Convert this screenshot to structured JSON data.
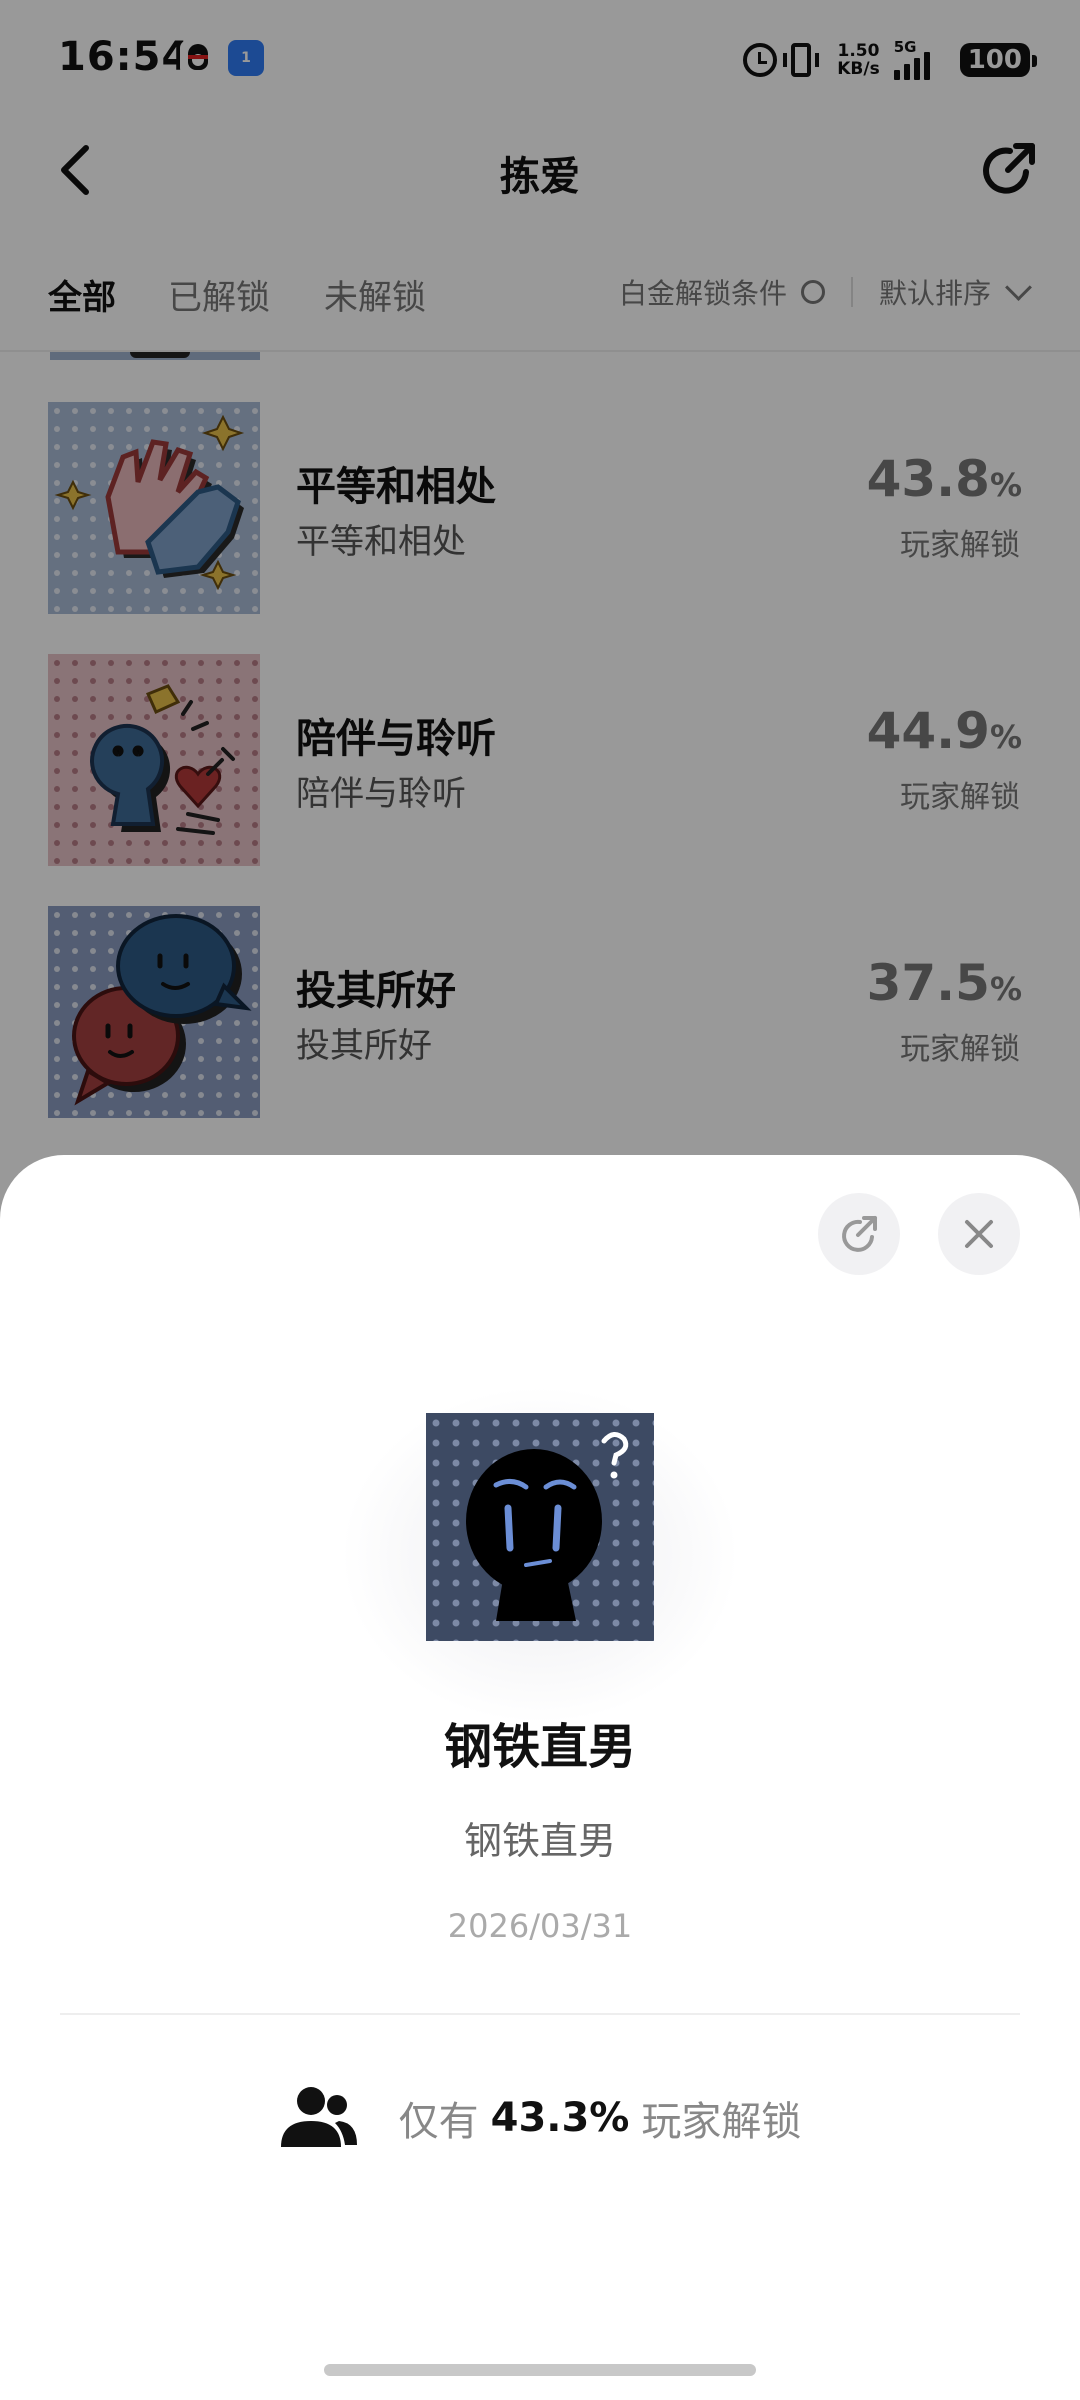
{
  "status_bar": {
    "time": "16:54",
    "net_speed_value": "1.50",
    "net_speed_unit": "KB/s",
    "signal_type": "5G",
    "battery": "100",
    "radio_badge": "1",
    "icons": [
      "qq-icon",
      "radio-icon",
      "alarm-icon",
      "vibrate-icon",
      "signal-icon",
      "battery-icon"
    ]
  },
  "nav": {
    "title": "拣爱",
    "back_icon": "back-arrow-icon",
    "share_icon": "share-icon"
  },
  "filter": {
    "tabs": [
      {
        "label": "全部",
        "active": true
      },
      {
        "label": "已解锁",
        "active": false
      },
      {
        "label": "未解锁",
        "active": false
      }
    ],
    "platinum_label": "白金解锁条件",
    "sort_label": "默认排序"
  },
  "achievements": [
    {
      "title": "平等和相处",
      "subtitle": "平等和相处",
      "percent": "43.8",
      "percent_sign": "%",
      "percent_label": "玩家解锁",
      "icon": "handshake-icon"
    },
    {
      "title": "陪伴与聆听",
      "subtitle": "陪伴与聆听",
      "percent": "44.9",
      "percent_sign": "%",
      "percent_label": "玩家解锁",
      "icon": "companion-heart-icon"
    },
    {
      "title": "投其所好",
      "subtitle": "投其所好",
      "percent": "37.5",
      "percent_sign": "%",
      "percent_label": "玩家解锁",
      "icon": "chat-bubbles-icon"
    }
  ],
  "sheet": {
    "title": "钢铁直男",
    "subtitle": "钢铁直男",
    "date": "2026/03/31",
    "unlock_prefix": "仅有",
    "unlock_percent": "43.3%",
    "unlock_suffix": "玩家解锁",
    "badge_icon": "confused-face-icon"
  },
  "colors": {
    "overlay": "#000000",
    "thumb_blue": "#a9bbd6",
    "thumb_pink": "#e7c1c6",
    "thumb_slate": "#8a9cc0",
    "badge_bg": "#3d4a63",
    "accent_red": "#9c3a3a",
    "accent_blue": "#2e5b86"
  }
}
